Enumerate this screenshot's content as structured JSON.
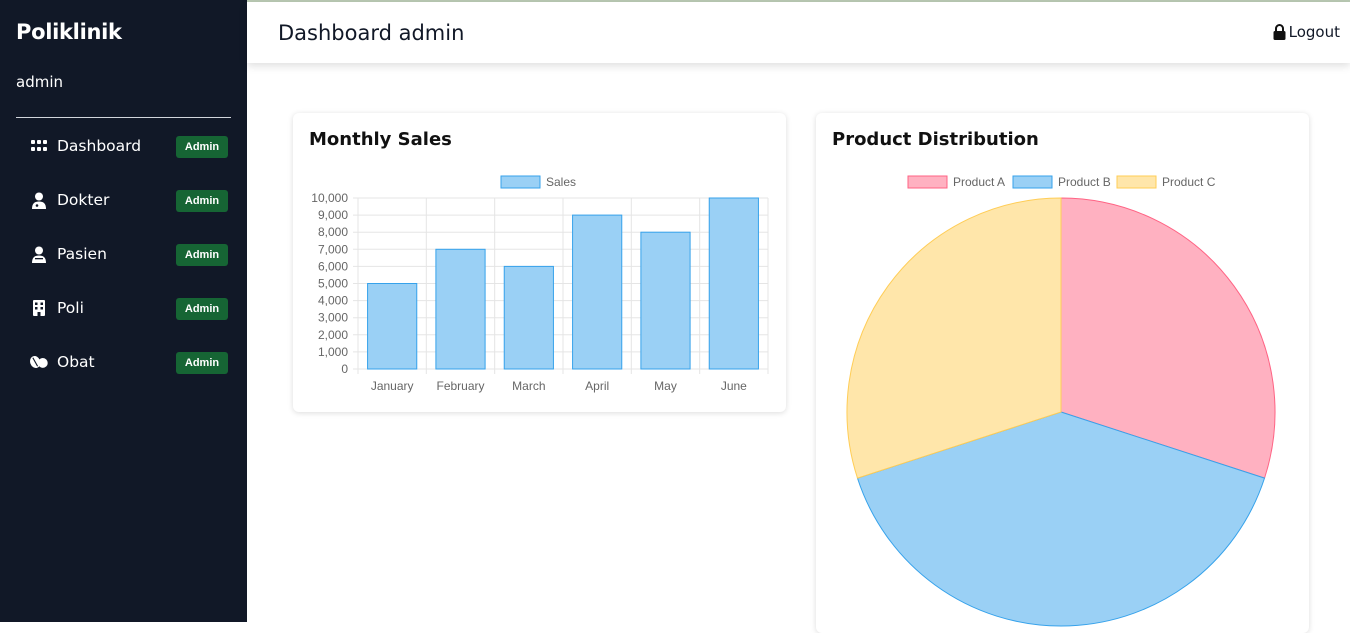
{
  "app": {
    "brand": "Poliklinik",
    "user": "admin"
  },
  "sidebar": {
    "items": [
      {
        "label": "Dashboard",
        "badge": "Admin",
        "icon": "grid-icon"
      },
      {
        "label": "Dokter",
        "badge": "Admin",
        "icon": "doctor-icon"
      },
      {
        "label": "Pasien",
        "badge": "Admin",
        "icon": "patient-icon"
      },
      {
        "label": "Poli",
        "badge": "Admin",
        "icon": "hospital-icon"
      },
      {
        "label": "Obat",
        "badge": "Admin",
        "icon": "pills-icon"
      }
    ]
  },
  "header": {
    "title": "Dashboard admin",
    "logout_label": "Logout",
    "logout_icon": "lock-icon"
  },
  "colors": {
    "sidebar_bg": "#111827",
    "badge_bg": "#166534",
    "bar_fill": "#9ad0f5",
    "bar_stroke": "#36a2eb",
    "pie_a_fill": "#ffb1c1",
    "pie_a_stroke": "#ff6384",
    "pie_b_fill": "#9ad0f5",
    "pie_b_stroke": "#36a2eb",
    "pie_c_fill": "#ffe6aa",
    "pie_c_stroke": "#ffcd56"
  },
  "cards": {
    "sales_title": "Monthly Sales",
    "distribution_title": "Product Distribution"
  },
  "chart_data": [
    {
      "type": "bar",
      "title": "Monthly Sales",
      "categories": [
        "January",
        "February",
        "March",
        "April",
        "May",
        "June"
      ],
      "series": [
        {
          "name": "Sales",
          "values": [
            5000,
            7000,
            6000,
            9000,
            8000,
            10000
          ]
        }
      ],
      "ylim": [
        0,
        10000
      ],
      "yticks": [
        "0",
        "1,000",
        "2,000",
        "3,000",
        "4,000",
        "5,000",
        "6,000",
        "7,000",
        "8,000",
        "9,000",
        "10,000"
      ],
      "grid": true,
      "legend": "top"
    },
    {
      "type": "pie",
      "title": "Product Distribution",
      "labels": [
        "Product A",
        "Product B",
        "Product C"
      ],
      "values": [
        30,
        40,
        30
      ],
      "legend": "top"
    }
  ]
}
